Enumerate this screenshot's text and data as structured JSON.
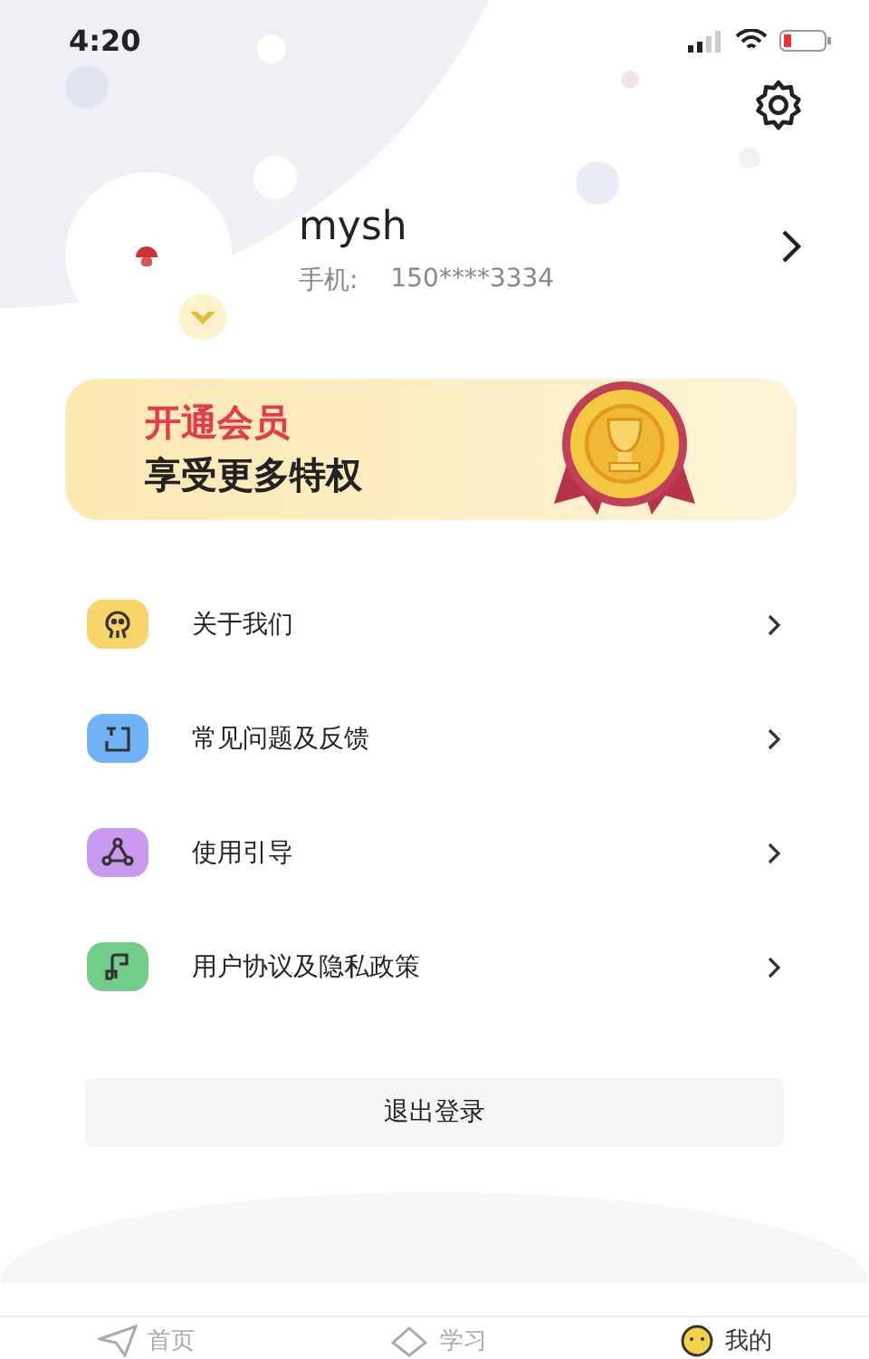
{
  "status_bar": {
    "time": "4:20"
  },
  "profile": {
    "name": "mysh",
    "phone_label": "手机:",
    "phone": "150****3334"
  },
  "banner": {
    "title": "开通会员",
    "subtitle": "享受更多特权"
  },
  "menu": [
    {
      "label": "关于我们",
      "kind": "about",
      "color": "#f7d46a"
    },
    {
      "label": "常见问题及反馈",
      "kind": "faq",
      "color": "#6fb2f5"
    },
    {
      "label": "使用引导",
      "kind": "guide",
      "color": "#c79af0"
    },
    {
      "label": "用户协议及隐私政策",
      "kind": "policy",
      "color": "#72cc8a"
    }
  ],
  "logout_button": "退出登录",
  "tabs": [
    {
      "label": "首页",
      "kind": "home",
      "selected": false
    },
    {
      "label": "学习",
      "kind": "study",
      "selected": false
    },
    {
      "label": "我的",
      "kind": "me",
      "selected": true
    }
  ]
}
